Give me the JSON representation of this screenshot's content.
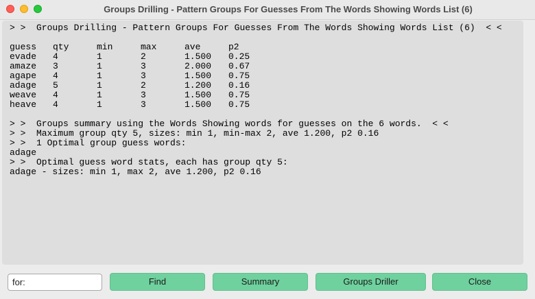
{
  "window": {
    "title": "Groups Drilling - Pattern Groups For Guesses From The Words Showing Words List (6)"
  },
  "output": {
    "header_line": "> >  Groups Drilling - Pattern Groups For Guesses From The Words Showing Words List (6)  < <",
    "table": {
      "columns": [
        "guess",
        "qty",
        "min",
        "max",
        "ave",
        "p2"
      ],
      "rows": [
        [
          "evade",
          "4",
          "1",
          "2",
          "1.500",
          "0.25"
        ],
        [
          "amaze",
          "3",
          "1",
          "3",
          "2.000",
          "0.67"
        ],
        [
          "agape",
          "4",
          "1",
          "3",
          "1.500",
          "0.75"
        ],
        [
          "adage",
          "5",
          "1",
          "2",
          "1.200",
          "0.16"
        ],
        [
          "weave",
          "4",
          "1",
          "3",
          "1.500",
          "0.75"
        ],
        [
          "heave",
          "4",
          "1",
          "3",
          "1.500",
          "0.75"
        ]
      ]
    },
    "summary_lines": [
      "> >  Groups summary using the Words Showing words for guesses on the 6 words.  < <",
      "> >  Maximum group qty 5, sizes: min 1, min-max 2, ave 1.200, p2 0.16",
      "> >  1 Optimal group guess words:",
      "adage",
      "> >  Optimal guess word stats, each has group qty 5:",
      "adage - sizes: min 1, max 2, ave 1.200, p2 0.16"
    ]
  },
  "controls": {
    "search_value": "for:",
    "find_label": "Find",
    "summary_label": "Summary",
    "groups_driller_label": "Groups Driller",
    "close_label": "Close"
  },
  "colors": {
    "button_bg": "#6fd19e",
    "text_area_bg": "#dedede",
    "window_bg": "#ececec",
    "close_dot": "#ff5f57",
    "minimize_dot": "#febc2e",
    "zoom_dot": "#28c840"
  }
}
